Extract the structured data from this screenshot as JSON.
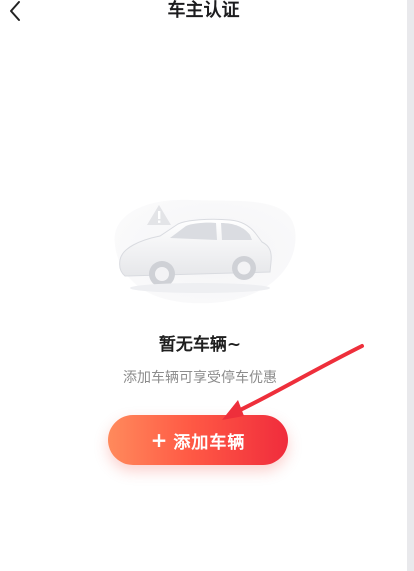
{
  "header": {
    "title": "车主认证",
    "back_icon": "chevron-left-icon"
  },
  "empty_state": {
    "illustration_icon": "car-warning-icon",
    "title": "暂无车辆~",
    "description": "添加车辆可享受停车优惠"
  },
  "actions": {
    "add_icon": "plus-icon",
    "add_label": "添加车辆"
  },
  "annotation": {
    "arrow_icon": "red-arrow-icon",
    "color": "#ee2f3b"
  }
}
